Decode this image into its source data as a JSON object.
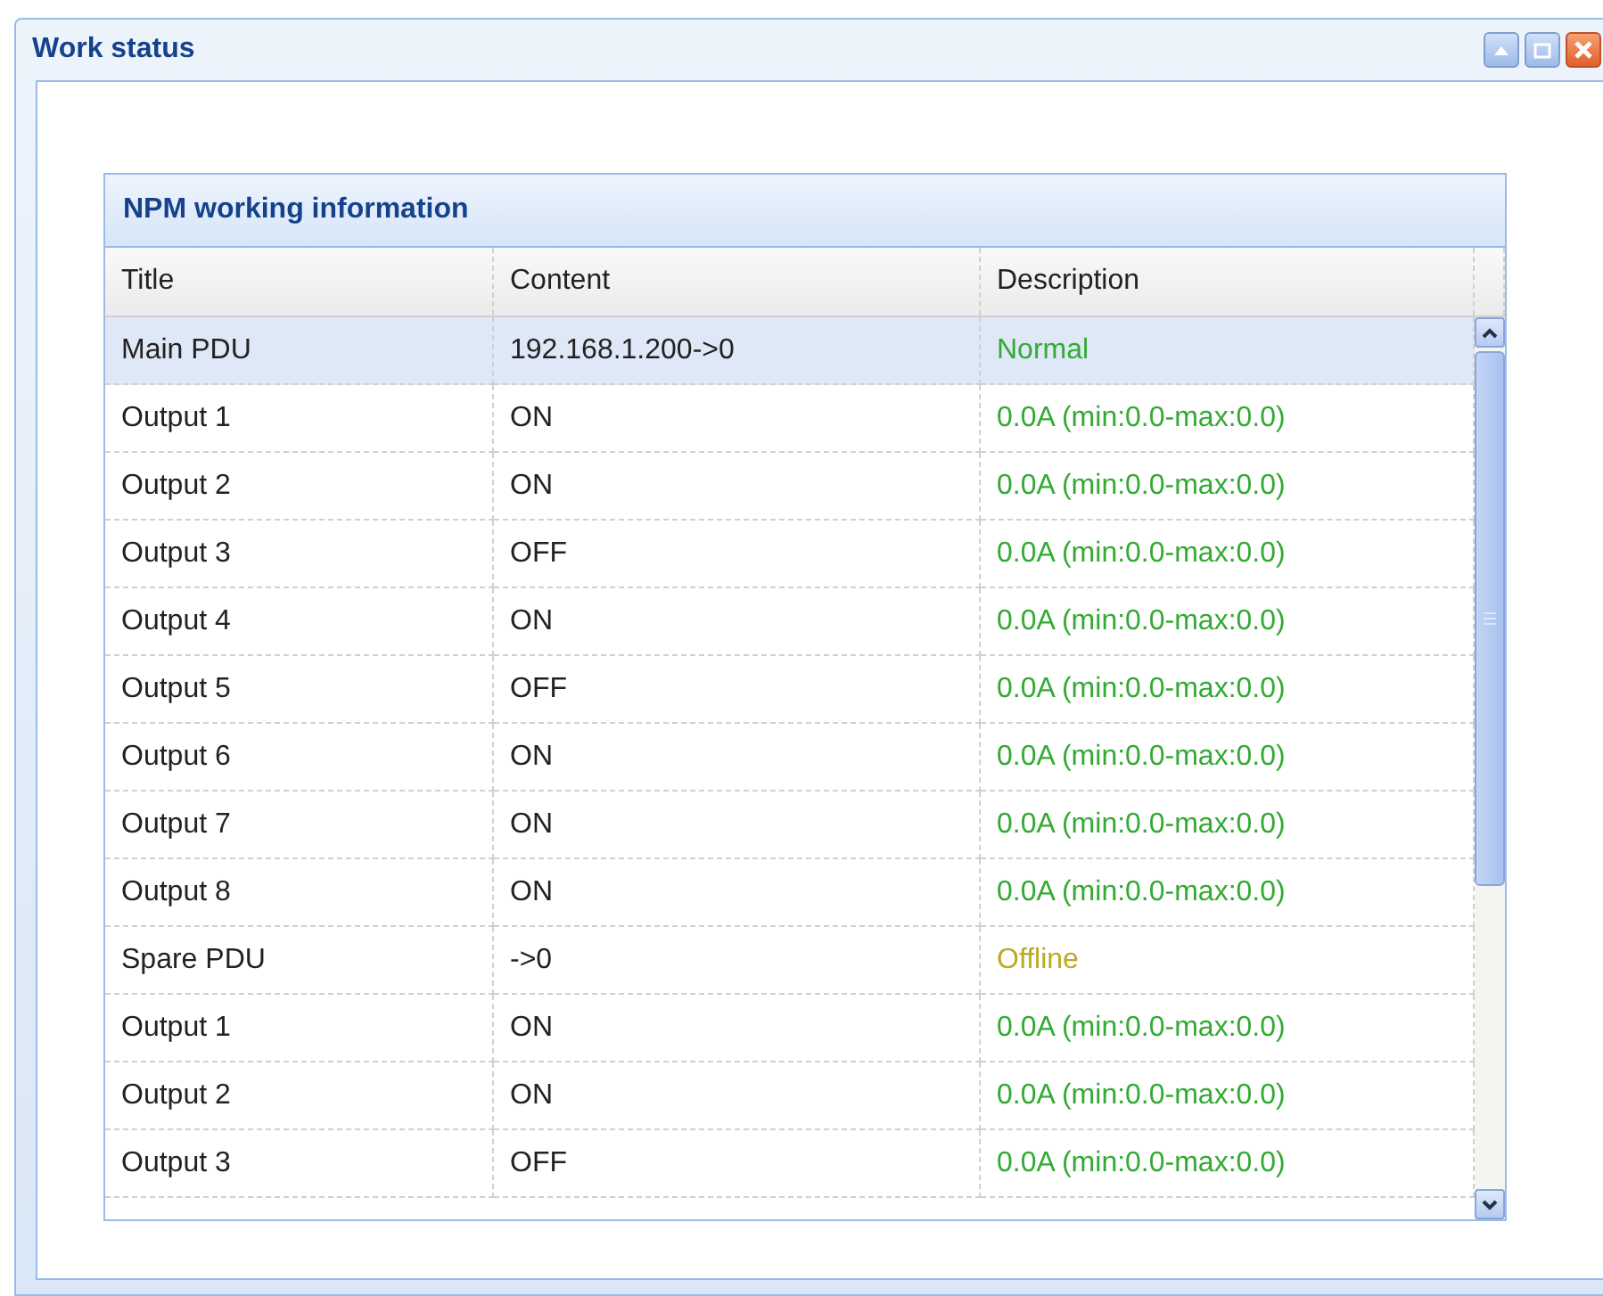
{
  "window": {
    "title": "Work status"
  },
  "grid": {
    "title": "NPM working information",
    "columns": [
      "Title",
      "Content",
      "Description"
    ],
    "rows": [
      {
        "title": "Main PDU",
        "content": "192.168.1.200->0",
        "description": "Normal",
        "color": "#33aa33",
        "selected": true
      },
      {
        "title": "Output 1",
        "content": "ON",
        "description": "0.0A (min:0.0-max:0.0)",
        "color": "#33aa33",
        "selected": false
      },
      {
        "title": "Output 2",
        "content": "ON",
        "description": "0.0A (min:0.0-max:0.0)",
        "color": "#33aa33",
        "selected": false
      },
      {
        "title": "Output 3",
        "content": "OFF",
        "description": "0.0A (min:0.0-max:0.0)",
        "color": "#33aa33",
        "selected": false
      },
      {
        "title": "Output 4",
        "content": "ON",
        "description": "0.0A (min:0.0-max:0.0)",
        "color": "#33aa33",
        "selected": false
      },
      {
        "title": "Output 5",
        "content": "OFF",
        "description": "0.0A (min:0.0-max:0.0)",
        "color": "#33aa33",
        "selected": false
      },
      {
        "title": "Output 6",
        "content": "ON",
        "description": "0.0A (min:0.0-max:0.0)",
        "color": "#33aa33",
        "selected": false
      },
      {
        "title": "Output 7",
        "content": "ON",
        "description": "0.0A (min:0.0-max:0.0)",
        "color": "#33aa33",
        "selected": false
      },
      {
        "title": "Output 8",
        "content": "ON",
        "description": "0.0A (min:0.0-max:0.0)",
        "color": "#33aa33",
        "selected": false
      },
      {
        "title": "Spare PDU",
        "content": "->0",
        "description": "Offline",
        "color": "#bbaa22",
        "selected": false
      },
      {
        "title": "Output 1",
        "content": "ON",
        "description": "0.0A (min:0.0-max:0.0)",
        "color": "#33aa33",
        "selected": false
      },
      {
        "title": "Output 2",
        "content": "ON",
        "description": "0.0A (min:0.0-max:0.0)",
        "color": "#33aa33",
        "selected": false
      },
      {
        "title": "Output 3",
        "content": "OFF",
        "description": "0.0A (min:0.0-max:0.0)",
        "color": "#33aa33",
        "selected": false
      }
    ]
  }
}
